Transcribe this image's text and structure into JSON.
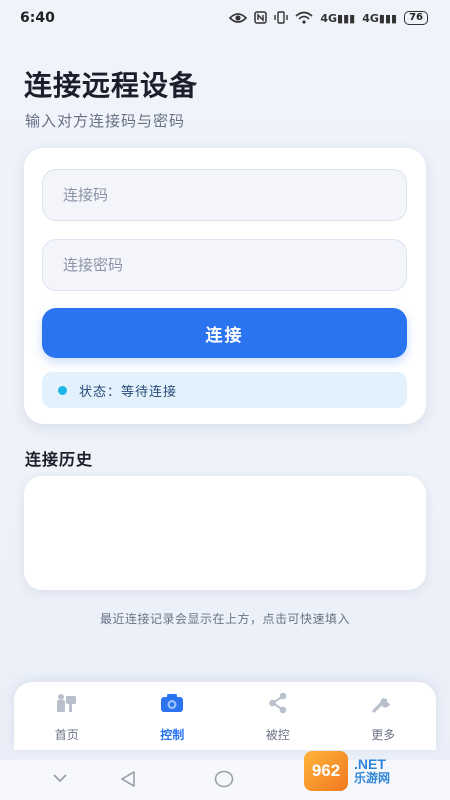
{
  "status_bar": {
    "time": "6:40",
    "battery": "76",
    "signal_1": "4G",
    "signal_2": "4G"
  },
  "header": {
    "title": "连接远程设备",
    "subtitle": "输入对方连接码与密码"
  },
  "form": {
    "code_placeholder": "连接码",
    "code_value": "",
    "password_placeholder": "连接密码",
    "password_value": "",
    "connect_label": "连接",
    "status_text": "状态：等待连接"
  },
  "history": {
    "title": "连接历史",
    "hint": "最近连接记录会显示在上方，点击可快速填入"
  },
  "bottom_nav": {
    "items": [
      {
        "label": "首页",
        "icon": "home-icon",
        "active": false
      },
      {
        "label": "控制",
        "icon": "camera-icon",
        "active": true
      },
      {
        "label": "被控",
        "icon": "share-icon",
        "active": false
      },
      {
        "label": "更多",
        "icon": "wrench-icon",
        "active": false
      }
    ]
  },
  "watermark": {
    "logo": "962",
    "domain": ".NET",
    "name": "乐游网"
  },
  "colors": {
    "accent": "#2b74f0",
    "status_dot": "#1fb6e6",
    "status_bg": "#e2f1fb",
    "background": "#eef2f9"
  }
}
